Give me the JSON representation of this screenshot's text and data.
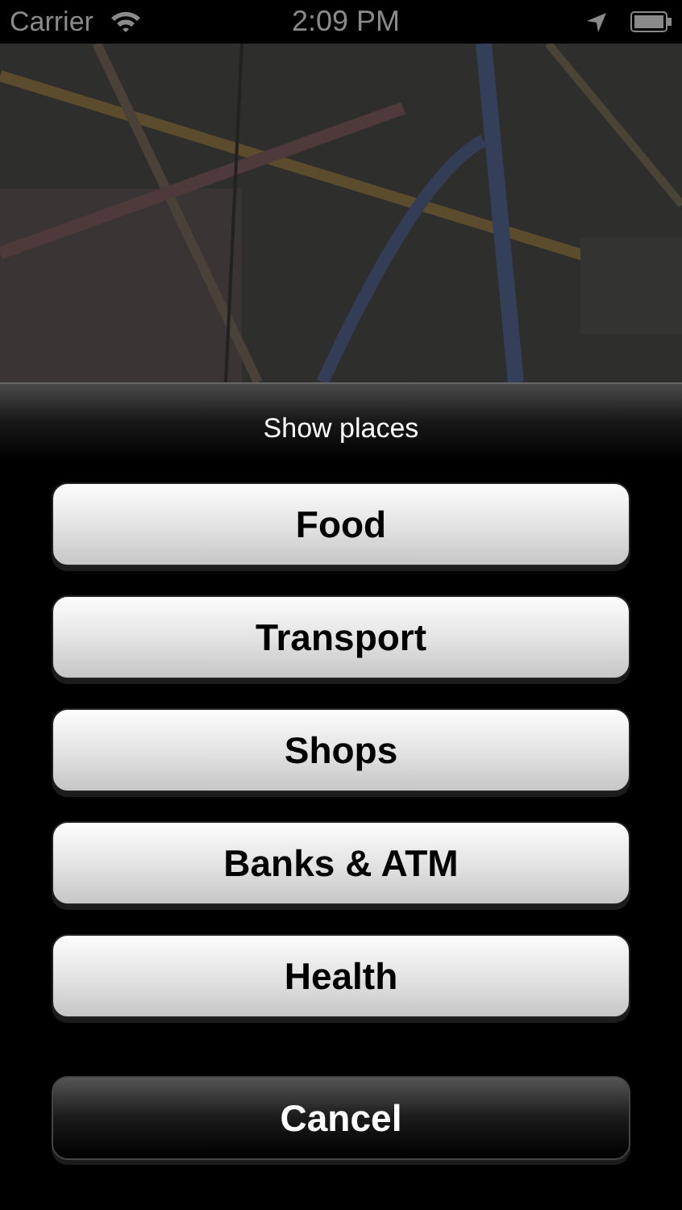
{
  "status_bar": {
    "carrier": "Carrier",
    "time": "2:09 PM"
  },
  "action_sheet": {
    "title": "Show places",
    "buttons": [
      {
        "label": "Food",
        "kind": "option"
      },
      {
        "label": "Transport",
        "kind": "option"
      },
      {
        "label": "Shops",
        "kind": "option"
      },
      {
        "label": "Banks & ATM",
        "kind": "option"
      },
      {
        "label": "Health",
        "kind": "option"
      },
      {
        "label": "Cancel",
        "kind": "cancel"
      }
    ]
  }
}
